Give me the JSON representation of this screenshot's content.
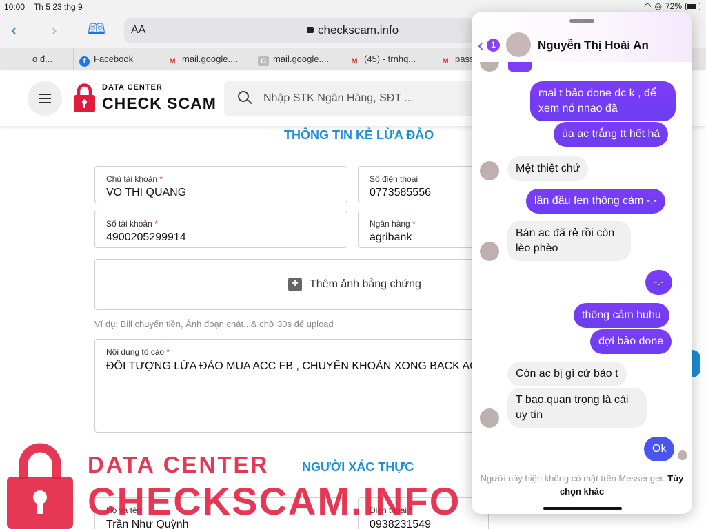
{
  "status_bar": {
    "time": "10:00",
    "date": "Th 5 23 thg 9",
    "battery": "72%"
  },
  "browser": {
    "text_size_label": "AA",
    "url": "checkscam.info"
  },
  "tabs": [
    {
      "label": "o đ...",
      "icon": "generic-favicon"
    },
    {
      "label": "Facebook",
      "icon": "facebook-icon"
    },
    {
      "label": "mail.google....",
      "icon": "gmail-icon"
    },
    {
      "label": "mail.google....",
      "icon": "generic-favicon"
    },
    {
      "label": "(45) - trnhq...",
      "icon": "gmail-icon"
    },
    {
      "label": "pass",
      "icon": "gmail-icon"
    }
  ],
  "site": {
    "logo_small": "DATA CENTER",
    "logo_big": "CHECK SCAM",
    "search_placeholder": "Nhập STK Ngân Hàng, SĐT ...",
    "brand_color": "#e21b3c",
    "accent_color": "#1a8fd8"
  },
  "form": {
    "section_title": "THÔNG TIN KẺ LỪA ĐẢO",
    "account_name_label": "Chủ tài khoản",
    "account_name": "VO THI QUANG",
    "phone_label": "Số điện thoại",
    "phone": "0773585556",
    "account_number_label": "Số tài khoản",
    "account_number": "4900205299914",
    "bank_label": "Ngân hàng",
    "bank": "agribank",
    "upload_label": "Thêm ảnh bằng chứng",
    "upload_hint": "Ví dụ: Bill chuyển tiền, Ảnh đoạn chát...& chờ 30s để upload",
    "report_label": "Nội dung tố cáo",
    "report_text": "ĐỐI TƯỢNG LỪA ĐẢO MUA ACC FB , CHUYỂN KHOẢN XONG BACK ACC LẠ",
    "verifier_title": "NGƯỜI XÁC THỰC",
    "verifier_name_label": "Họ và tên",
    "verifier_name": "Trần Như Quỳnh",
    "verifier_phone_label": "Điện thoại",
    "verifier_phone": "0938231549",
    "required_mark": "*"
  },
  "watermark": {
    "line1": "DATA CENTER",
    "line2": "CHECKSCAM.INFO"
  },
  "messenger": {
    "contact_name": "Nguyễn Thị Hoài An",
    "unread_count": "1",
    "messages": [
      {
        "from": "me",
        "text": "mai t bảo done dc k , để xem nó nnao đã"
      },
      {
        "from": "me",
        "text": "ùa ac trắng tt hết hả"
      },
      {
        "from": "them",
        "text": "Mệt thiệt chứ"
      },
      {
        "from": "me",
        "text": "lần đầu fen thông cảm -.-"
      },
      {
        "from": "them",
        "text": "Bán ac đã rẻ rồi còn lèo phèo"
      },
      {
        "from": "me",
        "text": "-.-"
      },
      {
        "from": "me",
        "text": "thông cảm huhu"
      },
      {
        "from": "me",
        "text": "đợi bảo done"
      },
      {
        "from": "them",
        "text": "Còn ac bị gì cứ bảo t"
      },
      {
        "from": "them",
        "text": "T bao.quan trọng là cái uy tín"
      },
      {
        "from": "me",
        "text": "Ok"
      }
    ],
    "footer_text": "Người này hiện không có mặt trên Messenger.",
    "footer_link": "Tùy chọn khác"
  }
}
